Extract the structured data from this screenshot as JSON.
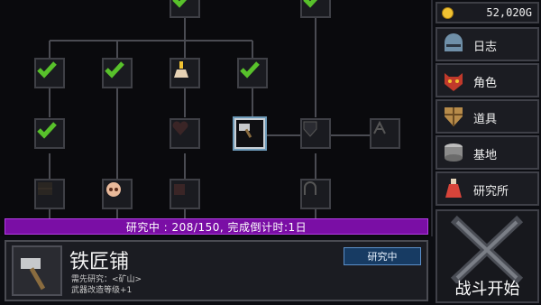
{
  "gold": {
    "amount": "52,020G"
  },
  "menu": [
    {
      "label": "日志",
      "icon": "helmet-icon",
      "color": "#6f8fa8"
    },
    {
      "label": "角色",
      "icon": "demon-mask-icon",
      "color": "#c0392b"
    },
    {
      "label": "道具",
      "icon": "shield-icon",
      "color": "#b78b4a"
    },
    {
      "label": "基地",
      "icon": "drum-icon",
      "color": "#8b8b8b"
    },
    {
      "label": "研究所",
      "icon": "potion-icon",
      "color": "#d8443a"
    }
  ],
  "battle": {
    "label": "战斗开始"
  },
  "progress": {
    "text": "研究中 : 208/150, 完成倒计时:1日"
  },
  "detail": {
    "title": "铁匠铺",
    "status": "研究中",
    "req_line1": "需先研究：<矿山>",
    "req_line2": "武器改造等级+1"
  },
  "colors": {
    "accent": "#7a0ea5",
    "check": "#58c12b",
    "status": "#173b63"
  }
}
